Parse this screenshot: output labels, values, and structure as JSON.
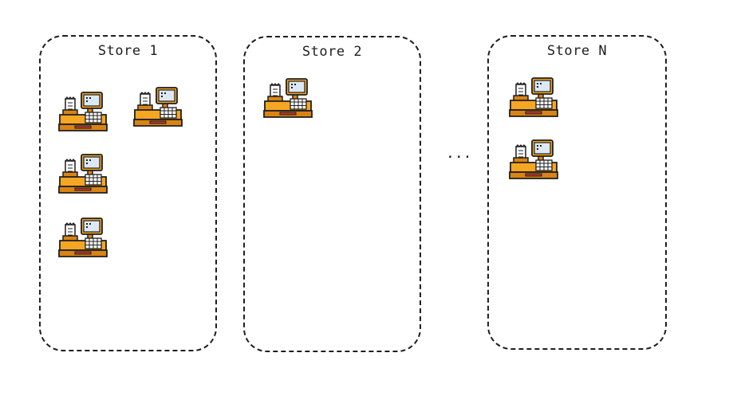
{
  "stores": [
    {
      "title": "Store 1",
      "registers": 4
    },
    {
      "title": "Store 2",
      "registers": 1
    },
    {
      "title": "Store N",
      "registers": 2
    }
  ],
  "ellipsis": "...",
  "icons": {
    "register": "cash-register-icon"
  },
  "colors": {
    "stroke": "#1e1e1e",
    "register_body": "#f5a623",
    "register_dark": "#d98414",
    "register_slot": "#c0392b",
    "screen": "#dbe9f5",
    "receipt": "#ffffff"
  }
}
